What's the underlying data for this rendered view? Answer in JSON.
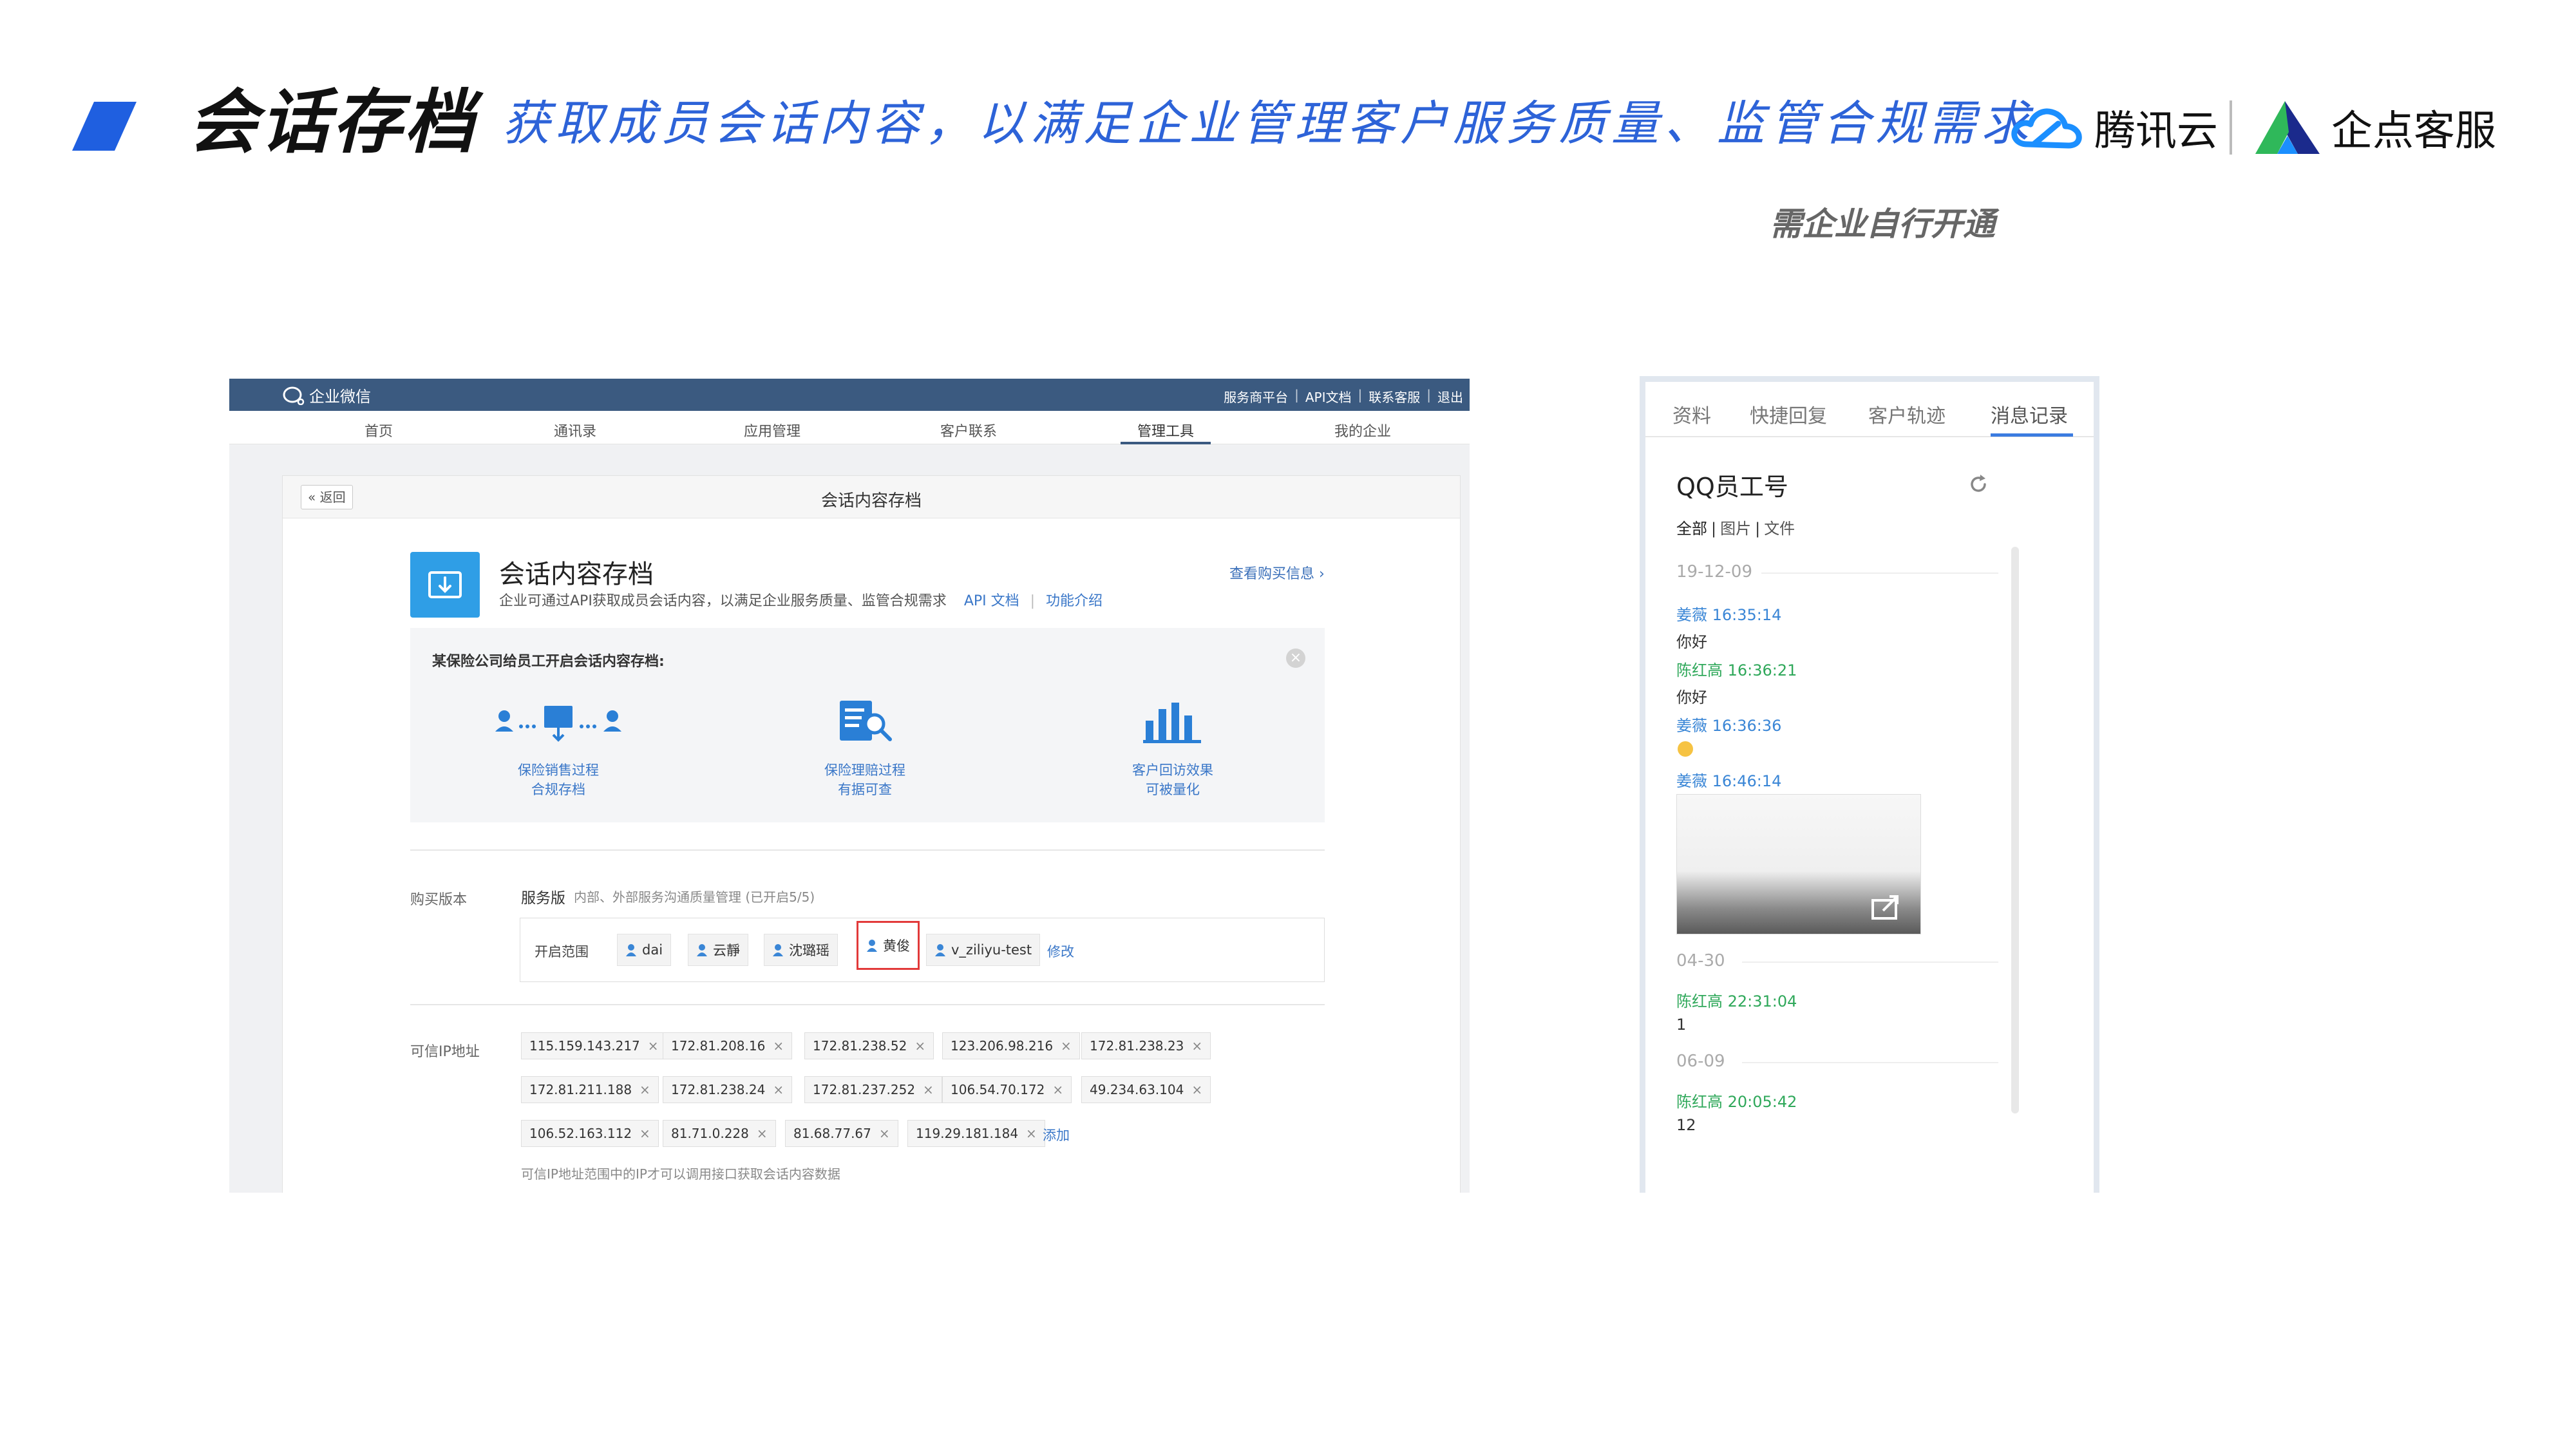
{
  "slide": {
    "title": "会话存档",
    "subtitle": "获取成员会话内容，以满足企业管理客户服务质量、监管合规需求",
    "note": "需企业自行开通",
    "logo_tencent": "腾讯云",
    "logo_qidian": "企点客服",
    "accent_color": "#1f5fe0"
  },
  "admin": {
    "brand": "企业微信",
    "top_links": [
      "服务商平台",
      "API文档",
      "联系客服",
      "退出"
    ],
    "nav": [
      {
        "label": "首页"
      },
      {
        "label": "通讯录"
      },
      {
        "label": "应用管理"
      },
      {
        "label": "客户联系"
      },
      {
        "label": "管理工具"
      },
      {
        "label": "我的企业"
      }
    ],
    "active_nav": "管理工具",
    "back_label": "« 返回",
    "panel_title": "会话内容存档",
    "feature": {
      "title": "会话内容存档",
      "desc": "企业可通过API获取成员会话内容，以满足企业服务质量、监管合规需求",
      "api_link": "API 文档",
      "intro_link": "功能介绍",
      "purchase_link": "查看购买信息 ›"
    },
    "case": {
      "title": "某保险公司给员工开启会话内容存档:",
      "items": [
        {
          "line1": "保险销售过程",
          "line2": "合规存档",
          "icon": "user-archive-flow-icon"
        },
        {
          "line1": "保险理赔过程",
          "line2": "有据可查",
          "icon": "document-search-icon"
        },
        {
          "line1": "客户回访效果",
          "line2": "可被量化",
          "icon": "bar-chart-icon"
        }
      ]
    },
    "version": {
      "label": "购买版本",
      "name": "服务版",
      "desc": "内部、外部服务沟通质量管理 (已开启5/5)"
    },
    "scope": {
      "label": "开启范围",
      "members": [
        "dai",
        "云靜",
        "沈璐瑶",
        "黄俊",
        "v_ziliyu-test"
      ],
      "highlighted": "黄俊",
      "edit": "修改"
    },
    "ip": {
      "label": "可信IP地址",
      "rows": [
        [
          "115.159.143.217",
          "172.81.208.16",
          "172.81.238.52",
          "123.206.98.216",
          "172.81.238.23"
        ],
        [
          "172.81.211.188",
          "172.81.238.24",
          "172.81.237.252",
          "106.54.70.172",
          "49.234.63.104"
        ],
        [
          "106.52.163.112",
          "81.71.0.228",
          "81.68.77.67",
          "119.29.181.184"
        ]
      ],
      "add": "添加",
      "note": "可信IP地址范围中的IP才可以调用接口获取会话内容数据"
    }
  },
  "side": {
    "tabs": [
      "资料",
      "快捷回复",
      "客户轨迹",
      "消息记录"
    ],
    "active_tab": "消息记录",
    "title": "QQ员工号",
    "filters": [
      "全部",
      "图片",
      "文件"
    ],
    "active_filter": "全部",
    "groups": [
      {
        "date": "19-12-09",
        "messages": [
          {
            "sender": "姜薇 16:35:14",
            "text": "你好",
            "color": "blue"
          },
          {
            "sender": "陈红高 16:36:21",
            "text": "你好",
            "color": "green"
          },
          {
            "sender": "姜薇 16:36:36",
            "text": "",
            "color": "blue",
            "emoji": true
          },
          {
            "sender": "姜薇 16:46:14",
            "text": "",
            "color": "blue",
            "image": true
          }
        ]
      },
      {
        "date": "04-30",
        "messages": [
          {
            "sender": "陈红高 22:31:04",
            "text": "1",
            "color": "green"
          }
        ]
      },
      {
        "date": "06-09",
        "messages": [
          {
            "sender": "陈红高 20:05:42",
            "text": "12",
            "color": "green"
          }
        ]
      }
    ]
  }
}
